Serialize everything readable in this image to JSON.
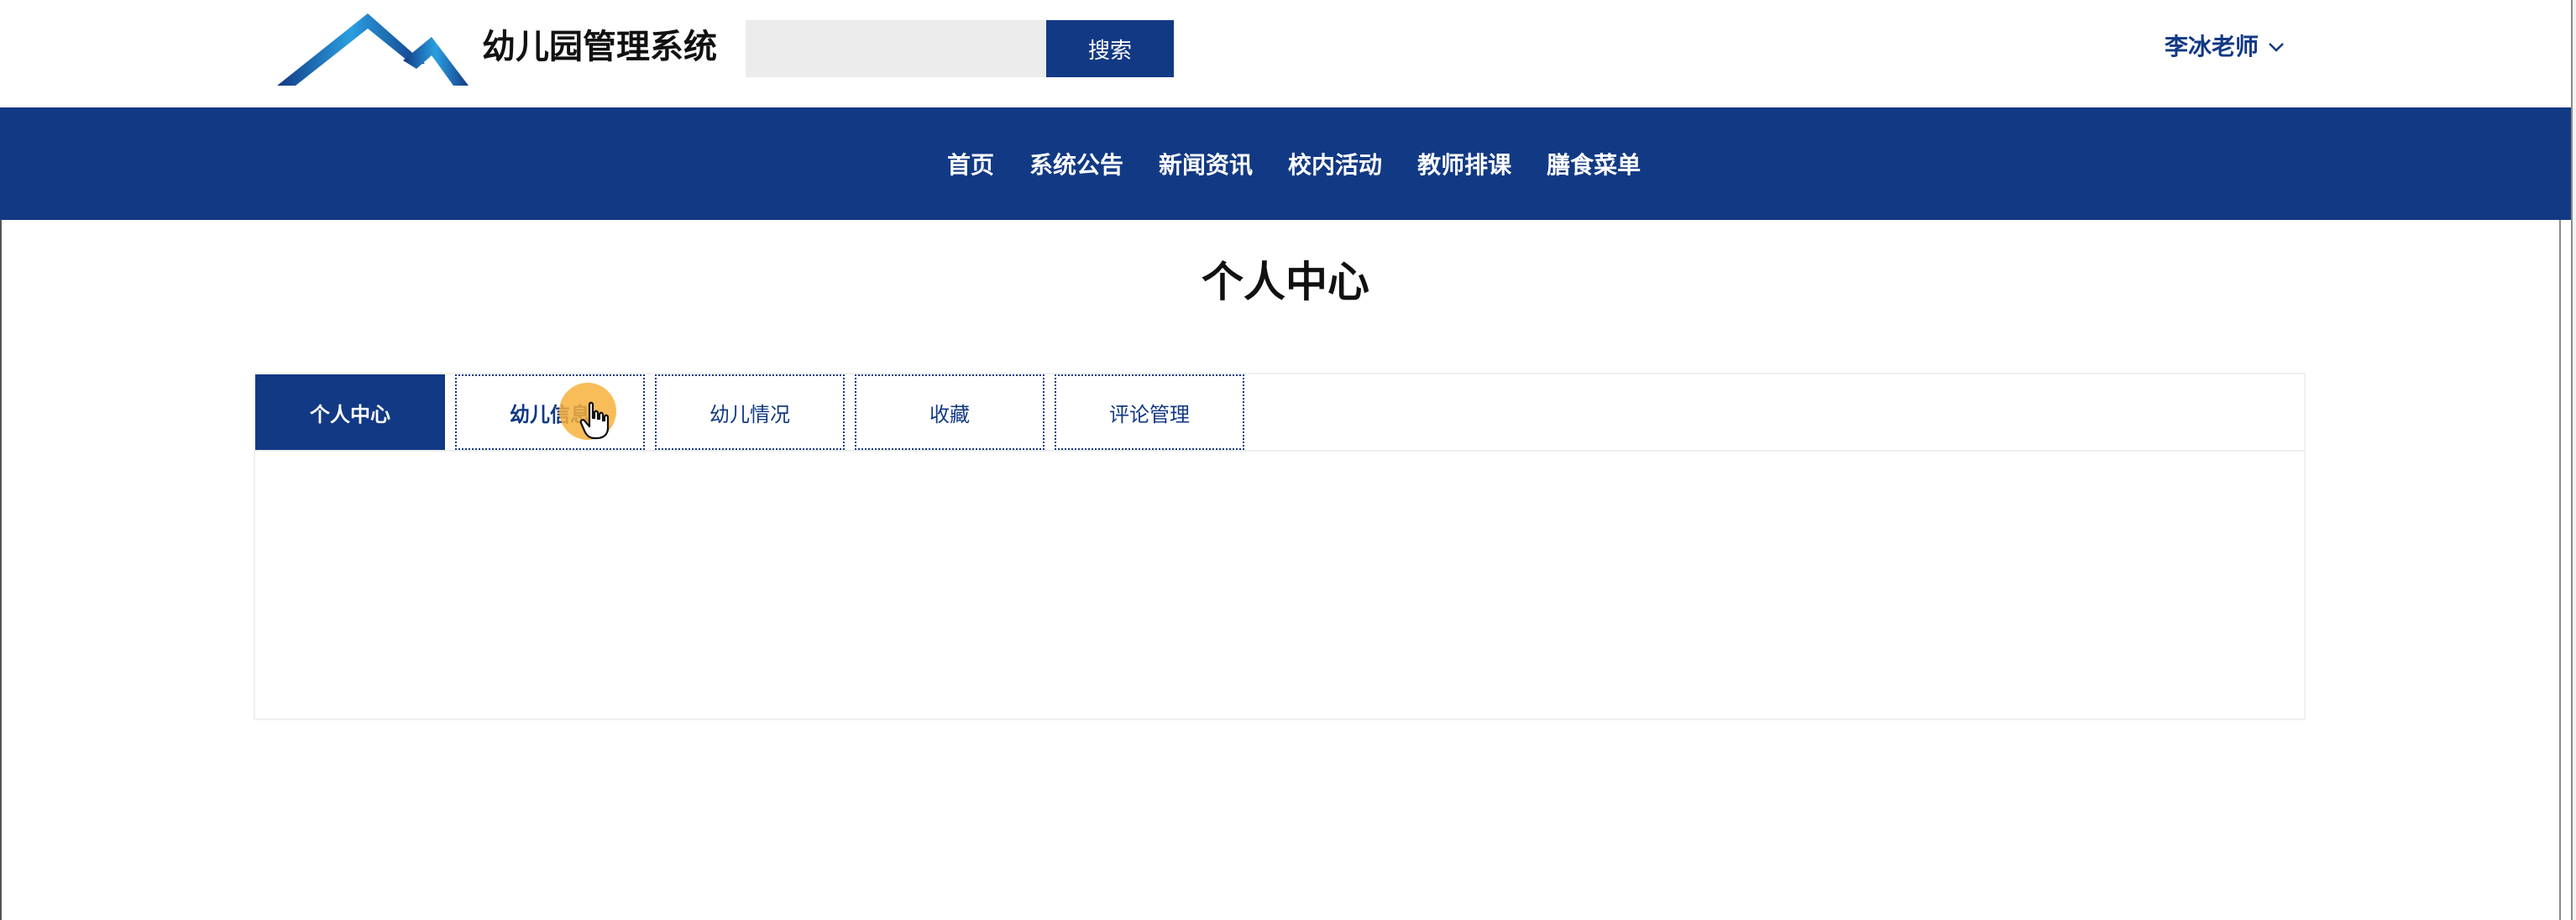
{
  "header": {
    "site_title": "幼儿园管理系统",
    "search": {
      "placeholder": "",
      "value": "",
      "button_label": "搜索"
    },
    "user_menu": {
      "label": "李冰老师"
    }
  },
  "nav": {
    "items": [
      {
        "label": "首页"
      },
      {
        "label": "系统公告"
      },
      {
        "label": "新闻资讯"
      },
      {
        "label": "校内活动"
      },
      {
        "label": "教师排课"
      },
      {
        "label": "膳食菜单"
      }
    ]
  },
  "main": {
    "page_title": "个人中心",
    "tabs": [
      {
        "label": "个人中心",
        "active": true
      },
      {
        "label": "幼儿信息",
        "active": false
      },
      {
        "label": "幼儿情况",
        "active": false
      },
      {
        "label": "收藏",
        "active": false
      },
      {
        "label": "评论管理",
        "active": false
      }
    ]
  },
  "colors": {
    "brand": "#123984",
    "logo_light": "#2a9fe0",
    "cursor_halo": "#f7b03c"
  },
  "icons": {
    "logo": "mountain-logo-icon",
    "user_menu_chevron": "chevron-down-icon",
    "cursor": "hand-pointer-icon"
  }
}
